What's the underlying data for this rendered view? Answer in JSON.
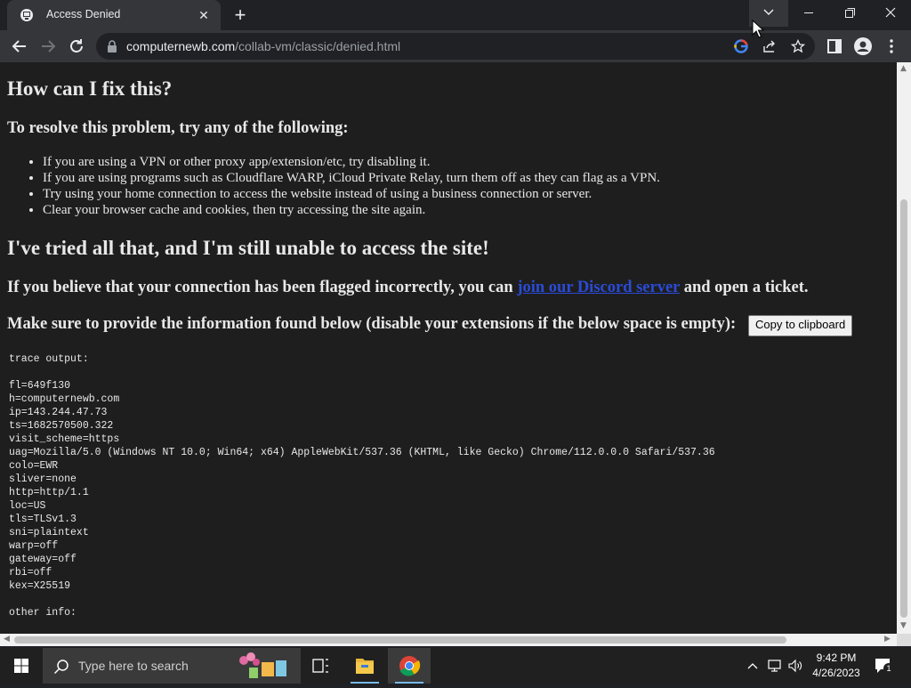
{
  "browser": {
    "tab": {
      "title": "Access Denied",
      "close": "✕"
    },
    "new_tab": "+",
    "window": {
      "minimize": "—",
      "restore": "❐",
      "close": "✕"
    },
    "address": {
      "host": "computernewb.com",
      "path": "/collab-vm/classic/denied.html"
    }
  },
  "page": {
    "heading_fix": "How can I fix this?",
    "subheading_resolve": "To resolve this problem, try any of the following:",
    "tips": [
      "If you are using a VPN or other proxy app/extension/etc, try disabling it.",
      "If you are using programs such as Cloudflare WARP, iCloud Private Relay, turn them off as they can flag as a VPN.",
      "Try using your home connection to access the website instead of using a business connection or server.",
      "Clear your browser cache and cookies, then try accessing the site again."
    ],
    "heading_tried": "I've tried all that, and I'm still unable to access the site!",
    "flagged_before": "If you believe that your connection has been flagged incorrectly, you can ",
    "flagged_link": "join our Discord server",
    "flagged_after": " and open a ticket.",
    "provide_info": "Make sure to provide the information found below (disable your extensions if the below space is empty):",
    "copy_button": "Copy to clipboard",
    "trace": "trace output:\n\nfl=649f130\nh=computernewb.com\nip=143.244.47.73\nts=1682570500.322\nvisit_scheme=https\nuag=Mozilla/5.0 (Windows NT 10.0; Win64; x64) AppleWebKit/537.36 (KHTML, like Gecko) Chrome/112.0.0.0 Safari/537.36\ncolo=EWR\nsliver=none\nhttp=http/1.1\nloc=US\ntls=TLSv1.3\nsni=plaintext\nwarp=off\ngateway=off\nrbi=off\nkex=X25519\n\nother info:"
  },
  "taskbar": {
    "search_placeholder": "Type here to search",
    "time": "9:42 PM",
    "date": "4/26/2023",
    "notifications_count": "1"
  },
  "colors": {
    "page_bg": "#1e1e1e",
    "page_text": "#e8e8e8",
    "link": "#2a4bd7",
    "chrome_frame": "#202124",
    "chrome_toolbar": "#35363a",
    "taskbar": "#202020"
  }
}
